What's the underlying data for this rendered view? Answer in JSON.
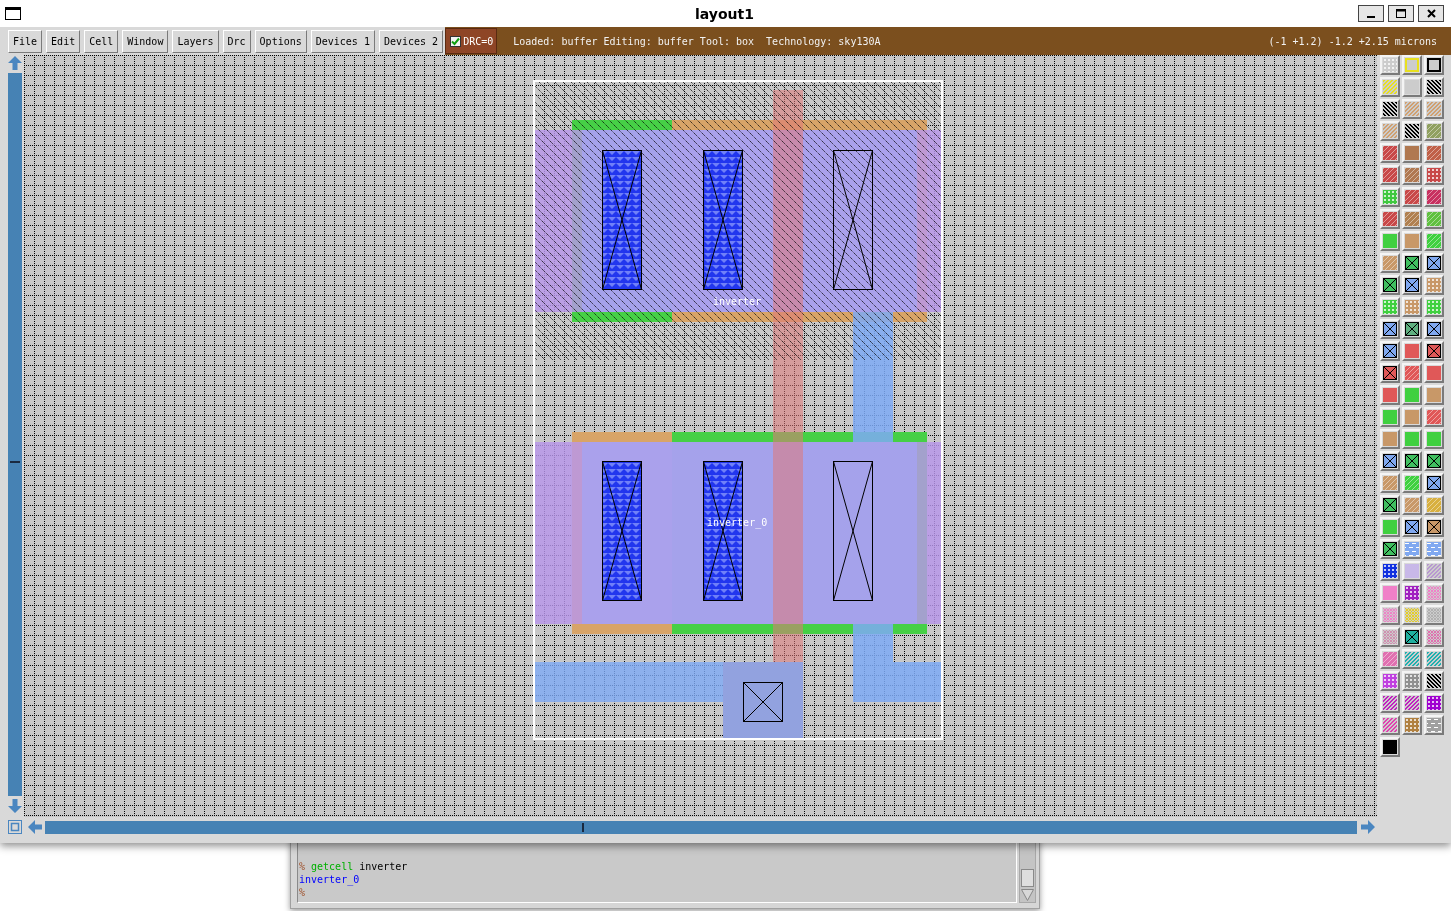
{
  "window": {
    "title": "layout1"
  },
  "menu": [
    "File",
    "Edit",
    "Cell",
    "Window",
    "Layers",
    "Drc",
    "Options",
    "Devices 1",
    "Devices 2"
  ],
  "drc": {
    "label": "DRC=0",
    "checked": true
  },
  "status": {
    "info": "Loaded: buffer Editing: buffer Tool: box  Technology: sky130A",
    "coordinates": "(-1 +1.2) -1.2 +2.15 microns"
  },
  "layout": {
    "cells": [
      {
        "label": "inverter"
      },
      {
        "label": "inverter_0"
      }
    ]
  },
  "layer_palette": [
    {
      "kind": "dots",
      "color": "#cccccc"
    },
    {
      "kind": "outline",
      "color": "#e8e020"
    },
    {
      "kind": "outline",
      "color": "#000000"
    },
    {
      "kind": "stripes",
      "color": "#e8e020"
    },
    {
      "kind": "solid",
      "color": "#cccccc"
    },
    {
      "kind": "backstripes",
      "color": "#000000"
    },
    {
      "kind": "backstripes",
      "color": "#000000"
    },
    {
      "kind": "stripes",
      "color": "#d0a070"
    },
    {
      "kind": "stripes",
      "color": "#d0a070"
    },
    {
      "kind": "stripes",
      "color": "#d0a070"
    },
    {
      "kind": "backstripes",
      "color": "#000000"
    },
    {
      "kind": "shaded",
      "color": "#90a060"
    },
    {
      "kind": "shaded",
      "color": "#c84848"
    },
    {
      "kind": "solid",
      "color": "#b07850"
    },
    {
      "kind": "shaded",
      "color": "#c06048"
    },
    {
      "kind": "shaded",
      "color": "#c84848"
    },
    {
      "kind": "shaded",
      "color": "#b07850"
    },
    {
      "kind": "dots",
      "color": "#c84848"
    },
    {
      "kind": "dots",
      "color": "#40c840"
    },
    {
      "kind": "shaded",
      "color": "#c84848"
    },
    {
      "kind": "shaded",
      "color": "#c83060"
    },
    {
      "kind": "shaded",
      "color": "#c84848"
    },
    {
      "kind": "shaded",
      "color": "#b08050"
    },
    {
      "kind": "shaded",
      "color": "#60c040"
    },
    {
      "kind": "solid",
      "color": "#40d040"
    },
    {
      "kind": "solid",
      "color": "#c89868"
    },
    {
      "kind": "shaded",
      "color": "#40d040"
    },
    {
      "kind": "shaded",
      "color": "#c89868"
    },
    {
      "kind": "contact",
      "color": "#40c060"
    },
    {
      "kind": "contact",
      "color": "#80a8f0"
    },
    {
      "kind": "contact",
      "color": "#40c060"
    },
    {
      "kind": "contact",
      "color": "#80a8f0"
    },
    {
      "kind": "dots",
      "color": "#c89868"
    },
    {
      "kind": "dots",
      "color": "#40d040"
    },
    {
      "kind": "dots",
      "color": "#c89868"
    },
    {
      "kind": "dots",
      "color": "#40d040"
    },
    {
      "kind": "contact",
      "color": "#80a8f0"
    },
    {
      "kind": "contact",
      "color": "#60b080"
    },
    {
      "kind": "contact",
      "color": "#80a8f0"
    },
    {
      "kind": "contact",
      "color": "#80a8f0"
    },
    {
      "kind": "solid",
      "color": "#e05858"
    },
    {
      "kind": "contact",
      "color": "#e05858"
    },
    {
      "kind": "contact",
      "color": "#e05858"
    },
    {
      "kind": "shaded",
      "color": "#e05858"
    },
    {
      "kind": "solid",
      "color": "#e05858"
    },
    {
      "kind": "solid",
      "color": "#e05858"
    },
    {
      "kind": "solid",
      "color": "#40d040"
    },
    {
      "kind": "solid",
      "color": "#c89868"
    },
    {
      "kind": "solid",
      "color": "#40d040"
    },
    {
      "kind": "solid",
      "color": "#c89868"
    },
    {
      "kind": "shaded",
      "color": "#e05858"
    },
    {
      "kind": "solid",
      "color": "#c89868"
    },
    {
      "kind": "solid",
      "color": "#40d040"
    },
    {
      "kind": "solid",
      "color": "#40d040"
    },
    {
      "kind": "contact",
      "color": "#80a8f0"
    },
    {
      "kind": "contact",
      "color": "#40c060"
    },
    {
      "kind": "contact",
      "color": "#40c060"
    },
    {
      "kind": "shaded",
      "color": "#c89868"
    },
    {
      "kind": "shaded",
      "color": "#40d040"
    },
    {
      "kind": "contact",
      "color": "#80a8f0"
    },
    {
      "kind": "contact",
      "color": "#40c060"
    },
    {
      "kind": "shaded",
      "color": "#c89868"
    },
    {
      "kind": "shaded",
      "color": "#d8b040"
    },
    {
      "kind": "solid",
      "color": "#40d040"
    },
    {
      "kind": "contact",
      "color": "#80a8f0"
    },
    {
      "kind": "contact",
      "color": "#c89868"
    },
    {
      "kind": "contact",
      "color": "#40c060"
    },
    {
      "kind": "wave",
      "color": "#80a8f0"
    },
    {
      "kind": "wave",
      "color": "#80a8f0"
    },
    {
      "kind": "dots",
      "color": "#1030e0"
    },
    {
      "kind": "solid",
      "color": "#c8b8e8"
    },
    {
      "kind": "stripes",
      "color": "#b898d0"
    },
    {
      "kind": "solid",
      "color": "#f080c8"
    },
    {
      "kind": "dots",
      "color": "#a020c0"
    },
    {
      "kind": "hatch",
      "color": "#f080c8"
    },
    {
      "kind": "hatch",
      "color": "#f080c8"
    },
    {
      "kind": "hatch",
      "color": "#e8d020"
    },
    {
      "kind": "hatch",
      "color": "#b0b0b0"
    },
    {
      "kind": "hatch",
      "color": "#d090b0"
    },
    {
      "kind": "contact",
      "color": "#20b0a0"
    },
    {
      "kind": "hatch",
      "color": "#e070b0"
    },
    {
      "kind": "shaded",
      "color": "#e070b0"
    },
    {
      "kind": "stripes",
      "color": "#20b0b0"
    },
    {
      "kind": "stripes",
      "color": "#20b0b0"
    },
    {
      "kind": "dots",
      "color": "#c040e0"
    },
    {
      "kind": "dots",
      "color": "#909090"
    },
    {
      "kind": "backstripes",
      "color": "#000000"
    },
    {
      "kind": "stripes",
      "color": "#c020c0"
    },
    {
      "kind": "stripes",
      "color": "#c020c0"
    },
    {
      "kind": "dots",
      "color": "#a000d0"
    },
    {
      "kind": "stripes",
      "color": "#e040b0"
    },
    {
      "kind": "dots",
      "color": "#b08040"
    },
    {
      "kind": "wave",
      "color": "#a0a0a0"
    },
    {
      "kind": "solid",
      "color": "#000000"
    }
  ],
  "console": {
    "lines": [
      {
        "kind": "command",
        "prompt": "%",
        "command": "getcell",
        "argument": "inverter"
      },
      {
        "kind": "output",
        "text": "inverter_0"
      },
      {
        "kind": "prompt",
        "prompt": "%"
      }
    ]
  }
}
